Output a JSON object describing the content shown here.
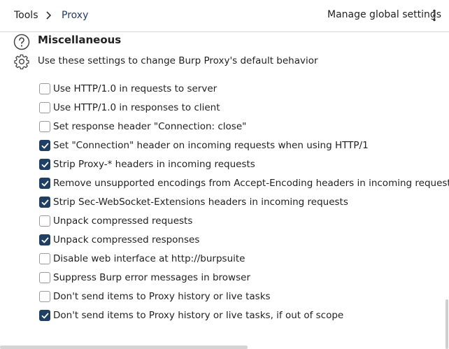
{
  "breadcrumb": {
    "root": "Tools",
    "current": "Proxy"
  },
  "header": {
    "manage_label": "Manage global settings"
  },
  "section": {
    "title": "Miscellaneous",
    "description": "Use these settings to change Burp Proxy's default behavior"
  },
  "options": [
    {
      "label": "Use HTTP/1.0 in requests to server",
      "checked": false
    },
    {
      "label": "Use HTTP/1.0 in responses to client",
      "checked": false
    },
    {
      "label": "Set response header \"Connection: close\"",
      "checked": false
    },
    {
      "label": "Set \"Connection\" header on incoming requests when using HTTP/1",
      "checked": true
    },
    {
      "label": "Strip Proxy-* headers in incoming requests",
      "checked": true
    },
    {
      "label": "Remove unsupported encodings from Accept-Encoding headers in incoming requests",
      "checked": true
    },
    {
      "label": "Strip Sec-WebSocket-Extensions headers in incoming requests",
      "checked": true
    },
    {
      "label": "Unpack compressed requests",
      "checked": false
    },
    {
      "label": "Unpack compressed responses",
      "checked": true
    },
    {
      "label": "Disable web interface at http://burpsuite",
      "checked": false
    },
    {
      "label": "Suppress Burp error messages in browser",
      "checked": false
    },
    {
      "label": "Don't send items to Proxy history or live tasks",
      "checked": false
    },
    {
      "label": "Don't send items to Proxy history or live tasks, if out of scope",
      "checked": true
    }
  ],
  "colors": {
    "accent": "#1f3f64",
    "link": "#1f3a5f"
  },
  "icons": {
    "breadcrumb_separator": "chevron-right-icon",
    "menu": "kebab-menu-icon",
    "help": "help-icon",
    "settings": "gear-icon",
    "check": "checkmark-icon"
  }
}
